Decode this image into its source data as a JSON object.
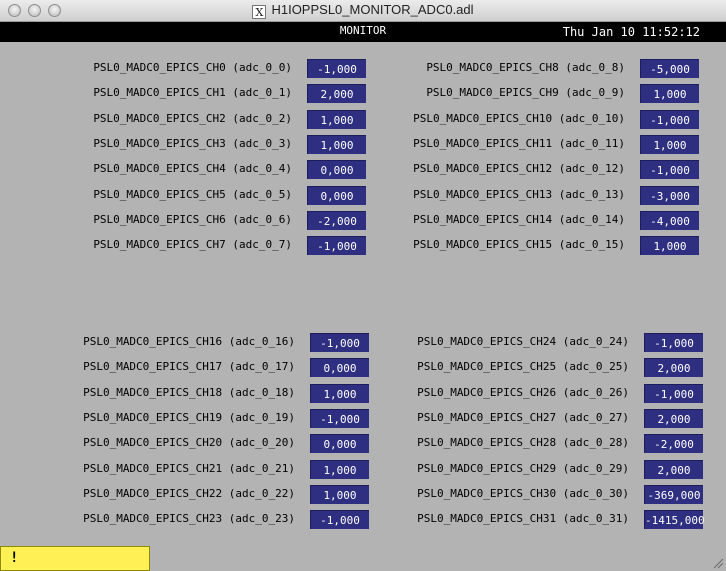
{
  "window": {
    "title": "H1IOPPSL0_MONITOR_ADC0.adl",
    "title_icon": "X"
  },
  "header": {
    "label": "MONITOR",
    "timestamp": "Thu Jan 10 11:52:12"
  },
  "channels": [
    {
      "label": "PSL0_MADC0_EPICS_CH0 (adc_0_0)",
      "value": "-1,000"
    },
    {
      "label": "PSL0_MADC0_EPICS_CH1 (adc_0_1)",
      "value": "2,000"
    },
    {
      "label": "PSL0_MADC0_EPICS_CH2 (adc_0_2)",
      "value": "1,000"
    },
    {
      "label": "PSL0_MADC0_EPICS_CH3 (adc_0_3)",
      "value": "1,000"
    },
    {
      "label": "PSL0_MADC0_EPICS_CH4 (adc_0_4)",
      "value": "0,000"
    },
    {
      "label": "PSL0_MADC0_EPICS_CH5 (adc_0_5)",
      "value": "0,000"
    },
    {
      "label": "PSL0_MADC0_EPICS_CH6 (adc_0_6)",
      "value": "-2,000"
    },
    {
      "label": "PSL0_MADC0_EPICS_CH7 (adc_0_7)",
      "value": "-1,000"
    },
    {
      "label": "PSL0_MADC0_EPICS_CH8 (adc_0_8)",
      "value": "-5,000"
    },
    {
      "label": "PSL0_MADC0_EPICS_CH9 (adc_0_9)",
      "value": "1,000"
    },
    {
      "label": "PSL0_MADC0_EPICS_CH10 (adc_0_10)",
      "value": "-1,000"
    },
    {
      "label": "PSL0_MADC0_EPICS_CH11 (adc_0_11)",
      "value": "1,000"
    },
    {
      "label": "PSL0_MADC0_EPICS_CH12 (adc_0_12)",
      "value": "-1,000"
    },
    {
      "label": "PSL0_MADC0_EPICS_CH13 (adc_0_13)",
      "value": "-3,000"
    },
    {
      "label": "PSL0_MADC0_EPICS_CH14 (adc_0_14)",
      "value": "-4,000"
    },
    {
      "label": "PSL0_MADC0_EPICS_CH15 (adc_0_15)",
      "value": "1,000"
    },
    {
      "label": "PSL0_MADC0_EPICS_CH16 (adc_0_16)",
      "value": "-1,000"
    },
    {
      "label": "PSL0_MADC0_EPICS_CH17 (adc_0_17)",
      "value": "0,000"
    },
    {
      "label": "PSL0_MADC0_EPICS_CH18 (adc_0_18)",
      "value": "1,000"
    },
    {
      "label": "PSL0_MADC0_EPICS_CH19 (adc_0_19)",
      "value": "-1,000"
    },
    {
      "label": "PSL0_MADC0_EPICS_CH20 (adc_0_20)",
      "value": "0,000"
    },
    {
      "label": "PSL0_MADC0_EPICS_CH21 (adc_0_21)",
      "value": "1,000"
    },
    {
      "label": "PSL0_MADC0_EPICS_CH22 (adc_0_22)",
      "value": "1,000"
    },
    {
      "label": "PSL0_MADC0_EPICS_CH23 (adc_0_23)",
      "value": "-1,000"
    },
    {
      "label": "PSL0_MADC0_EPICS_CH24 (adc_0_24)",
      "value": "-1,000"
    },
    {
      "label": "PSL0_MADC0_EPICS_CH25 (adc_0_25)",
      "value": "2,000"
    },
    {
      "label": "PSL0_MADC0_EPICS_CH26 (adc_0_26)",
      "value": "-1,000"
    },
    {
      "label": "PSL0_MADC0_EPICS_CH27 (adc_0_27)",
      "value": "2,000"
    },
    {
      "label": "PSL0_MADC0_EPICS_CH28 (adc_0_28)",
      "value": "-2,000"
    },
    {
      "label": "PSL0_MADC0_EPICS_CH29 (adc_0_29)",
      "value": "2,000"
    },
    {
      "label": "PSL0_MADC0_EPICS_CH30 (adc_0_30)",
      "value": "-369,000"
    },
    {
      "label": "PSL0_MADC0_EPICS_CH31 (adc_0_31)",
      "value": "-1415,000"
    }
  ],
  "status_bar": {
    "text": "!"
  },
  "colors": {
    "value_bg": "#2f2f81",
    "panel_bg": "#b3b3b3",
    "status_bg": "#fff155"
  }
}
